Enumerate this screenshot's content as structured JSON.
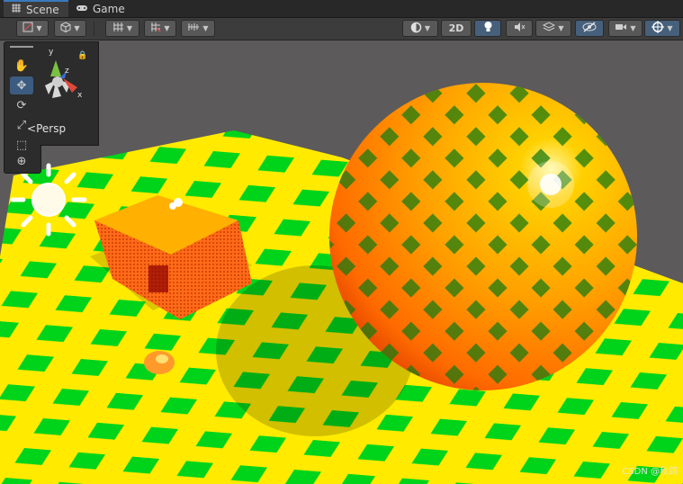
{
  "tabs": [
    {
      "label": "Scene",
      "icon": "grid-icon",
      "active": true
    },
    {
      "label": "Game",
      "icon": "gamepad-icon",
      "active": false
    }
  ],
  "toolbar": {
    "left_icons": [
      "draw-mode-icon",
      "scene-cube-icon",
      "grid-snap-icon",
      "grid-visibility-icon",
      "increment-snap-icon"
    ],
    "right_icons": [
      "shading-sphere-icon",
      "lighting-icon",
      "audio-icon",
      "effects-icon",
      "hidden-objects-icon",
      "camera-icon",
      "gizmos-icon"
    ],
    "mode_2d_label": "2D"
  },
  "tools": [
    "view-tool-icon",
    "move-tool-icon",
    "rotate-tool-icon",
    "scale-tool-icon",
    "rect-tool-icon",
    "transform-tool-icon"
  ],
  "gizmo": {
    "axis_y": "y",
    "axis_x": "x",
    "axis_z": "z",
    "projection_label": "Persp"
  },
  "watermark": "CSDN @秋鸽",
  "colors": {
    "floor_yellow": "#ffea00",
    "floor_green": "#00d41a",
    "sphere_orange": "#ff8c00",
    "cube_orange": "#ff6a1a",
    "accent_blue": "#3a79bb"
  }
}
